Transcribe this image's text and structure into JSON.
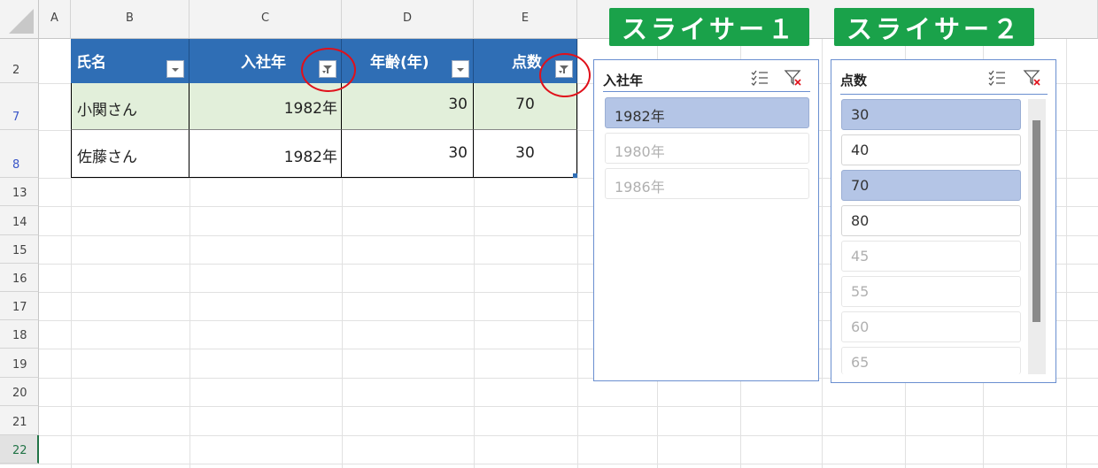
{
  "columns": [
    "A",
    "B",
    "C",
    "D",
    "E"
  ],
  "rows": [
    "2",
    "7",
    "8",
    "13",
    "14",
    "15",
    "16",
    "17",
    "18",
    "19",
    "20",
    "21",
    "22"
  ],
  "table": {
    "headers": [
      "氏名",
      "入社年",
      "年齢(年)",
      "点数"
    ],
    "data": [
      [
        "小関さん",
        "1982年",
        "30",
        "70"
      ],
      [
        "佐藤さん",
        "1982年",
        "30",
        "30"
      ]
    ]
  },
  "banners": [
    "スライサー１",
    "スライサー２"
  ],
  "slicer1": {
    "title": "入社年",
    "items": [
      {
        "label": "1982年",
        "state": "selected"
      },
      {
        "label": "1980年",
        "state": "unavailable"
      },
      {
        "label": "1986年",
        "state": "unavailable"
      }
    ]
  },
  "slicer2": {
    "title": "点数",
    "items": [
      {
        "label": "30",
        "state": "selected"
      },
      {
        "label": "40",
        "state": "available"
      },
      {
        "label": "70",
        "state": "selected"
      },
      {
        "label": "80",
        "state": "available"
      },
      {
        "label": "45",
        "state": "unavailable"
      },
      {
        "label": "55",
        "state": "unavailable"
      },
      {
        "label": "60",
        "state": "unavailable"
      },
      {
        "label": "65",
        "state": "unavailable"
      }
    ]
  },
  "icons": {
    "multi_select": "multi-select-icon",
    "clear_filter": "clear-filter-icon",
    "dropdown": "dropdown-arrow-icon",
    "filter_active": "filter-active-icon"
  },
  "colors": {
    "table_header": "#2f6eb5",
    "highlight_row": "#e2efda",
    "slicer_selected": "#b4c5e6",
    "banner": "#1aa24a",
    "annotation": "#e0101a"
  }
}
